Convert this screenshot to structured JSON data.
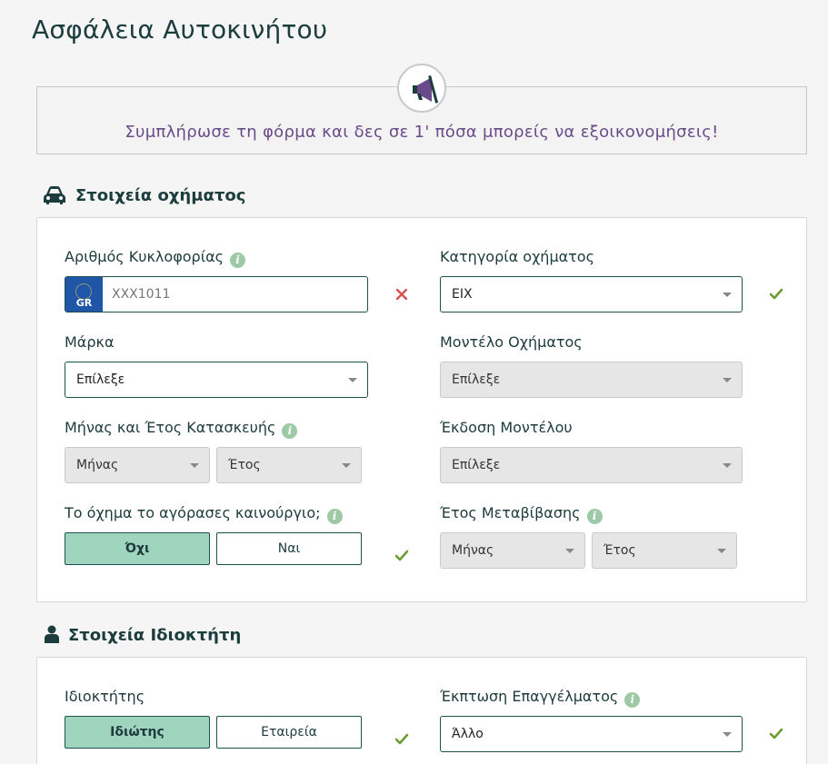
{
  "page": {
    "title": "Ασφάλεια Αυτοκινήτου"
  },
  "banner": {
    "text": "Συμπλήρωσε τη φόρμα και δες σε 1' πόσα μπορείς να εξοικονομήσεις!",
    "icon": "megaphone-icon"
  },
  "vehicle_section": {
    "title": "Στοιχεία οχήματος",
    "icon": "car-icon",
    "plate": {
      "label": "Αριθμός Κυκλοφορίας",
      "country": "GR",
      "placeholder": "XXX1011",
      "value": "",
      "status": "invalid"
    },
    "category": {
      "label": "Κατηγορία οχήματος",
      "value": "ΕΙΧ",
      "status": "valid"
    },
    "make": {
      "label": "Μάρκα",
      "value": "Επίλεξε"
    },
    "model": {
      "label": "Μοντέλο Οχήματος",
      "value": "Επίλεξε",
      "disabled": true
    },
    "manufacture": {
      "label": "Μήνας και Έτος Κατασκευής",
      "month": "Μήνας",
      "year": "Έτος"
    },
    "version": {
      "label": "Έκδοση Μοντέλου",
      "value": "Επίλεξε",
      "disabled": true
    },
    "bought_new": {
      "label": "Το όχημα το αγόρασες καινούργιο;",
      "options": [
        "Όχι",
        "Ναι"
      ],
      "selected": "Όχι",
      "status": "valid"
    },
    "transfer_year": {
      "label": "Έτος Μεταβίβασης",
      "month": "Μήνας",
      "year": "Έτος",
      "disabled": true
    }
  },
  "owner_section": {
    "title": "Στοιχεία Ιδιοκτήτη",
    "icon": "user-icon",
    "owner": {
      "label": "Ιδιοκτήτης",
      "options": [
        "Ιδιώτης",
        "Εταιρεία"
      ],
      "selected": "Ιδιώτης",
      "status": "valid"
    },
    "profession_discount": {
      "label": "Έκπτωση Επαγγέλματος",
      "value": "Άλλο",
      "status": "valid"
    }
  },
  "colors": {
    "accent": "#9fd4bf",
    "border": "#1d4f4f",
    "valid": "#6a9a2a",
    "invalid": "#d9534f",
    "banner_text": "#6b4a8a",
    "info": "#9ec9a6"
  }
}
